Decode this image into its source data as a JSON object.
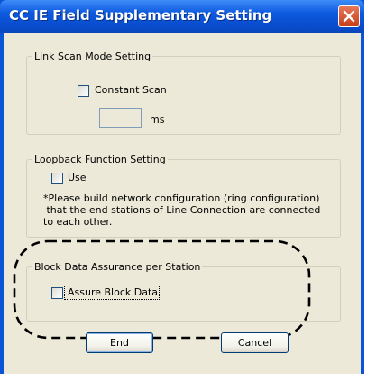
{
  "window": {
    "title": "CC IE Field Supplementary Setting"
  },
  "link_scan": {
    "legend": "Link Scan Mode Setting",
    "constant_scan_label": "Constant Scan",
    "constant_scan_checked": false,
    "time_value": "",
    "unit": "ms"
  },
  "loopback": {
    "legend": "Loopback Function Setting",
    "use_label": "Use",
    "use_checked": false,
    "note_lines": [
      "*Please build network configuration (ring configuration)",
      " that the end stations of Line Connection are connected",
      "to each other."
    ]
  },
  "block_data": {
    "legend": "Block Data Assurance per Station",
    "assure_label": "Assure Block Data",
    "assure_checked": false
  },
  "buttons": {
    "end": "End",
    "cancel": "Cancel"
  },
  "colors": {
    "title_bar": "#0d5ae0",
    "client_bg": "#ece9d8",
    "close_button": "#d3522c",
    "highlight_outline": "#000000"
  }
}
